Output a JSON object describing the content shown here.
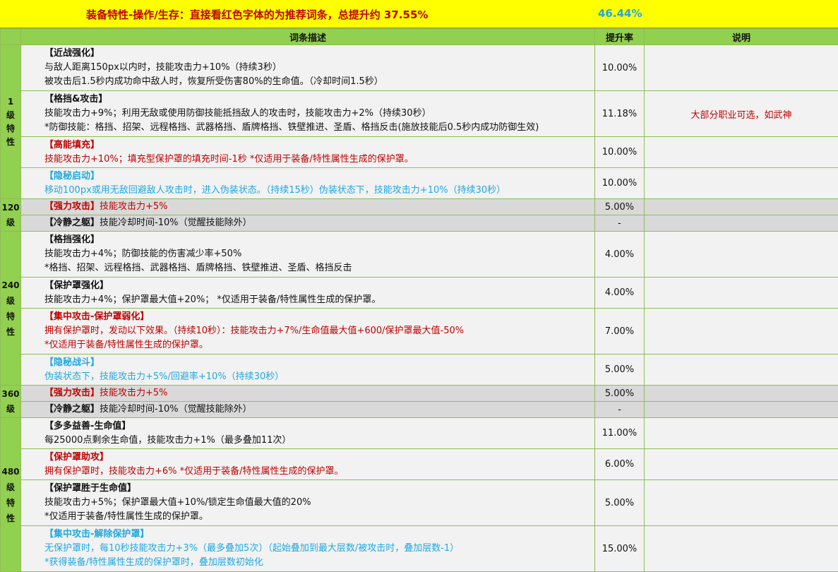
{
  "banner": {
    "title": "装备特性-操作/生存：直接看红色字体的为推荐词条，总提升约 37.55%",
    "total_alt": "46.44%"
  },
  "headers": {
    "description": "词条描述",
    "rate": "提升率",
    "note": "说明"
  },
  "levels": {
    "l1": "1\n级\n特\n性",
    "l120": "120\n级",
    "l240": "240\n级\n特\n性",
    "l360": "360\n级",
    "l480": "480\n级\n特\n性"
  },
  "rows": [
    {
      "name": "【近战强化】",
      "lines": [
        "与敌人距离150px以内时，技能攻击力+10%（持续3秒）",
        "被攻击后1.5秒内成功命中敌人时，恢复所受伤害80%的生命值。（冷却时间1.5秒）"
      ],
      "rate": "10.00%"
    },
    {
      "name": "【格挡&攻击】",
      "lines": [
        "技能攻击力+9%；利用无敌或使用防御技能抵挡敌人的攻击时，技能攻击力+2%（持续30秒）",
        "*防御技能：格挡、招架、远程格挡、武器格挡、盾牌格挡、铁壁推进、圣盾、格挡反击(施放技能后0.5秒内成功防御生效)"
      ],
      "rate": "11.18%",
      "note": "大部分职业可选，如武神"
    },
    {
      "name": "【高能填充】",
      "lines": [
        "技能攻击力+10%；填充型保护罩的填充时间-1秒 *仅适用于装备/特性属性生成的保护罩。"
      ],
      "rate": "10.00%"
    },
    {
      "name": "【隐秘启动】",
      "lines": [
        "移动100px或用无敌回避敌人攻击时，进入伪装状态。（持续15秒）伪装状态下，技能攻击力+10%（持续30秒）"
      ],
      "rate": "10.00%"
    },
    {
      "name": "【强力攻击】",
      "inline": "技能攻击力+5%",
      "rate": "5.00%"
    },
    {
      "name": "【冷静之躯】",
      "inline": "技能冷却时间-10%（觉醒技能除外）",
      "rate": "-"
    },
    {
      "name": "【格挡强化】",
      "lines": [
        "技能攻击力+4%；防御技能的伤害减少率+50%",
        "*格挡、招架、远程格挡、武器格挡、盾牌格挡、铁壁推进、圣盾、格挡反击"
      ],
      "rate": "4.00%"
    },
    {
      "name": "【保护罩强化】",
      "lines": [
        "技能攻击力+4%；保护罩最大值+20%； *仅适用于装备/特性属性生成的保护罩。"
      ],
      "rate": "4.00%"
    },
    {
      "name": "【集中攻击-保护罩弱化】",
      "lines": [
        "拥有保护罩时，发动以下效果。（持续10秒）：技能攻击力+7%/生命值最大值+600/保护罩最大值-50%",
        "*仅适用于装备/特性属性生成的保护罩。"
      ],
      "rate": "7.00%"
    },
    {
      "name": "【隐秘战斗】",
      "lines": [
        "伪装状态下，技能攻击力+5%/回避率+10%（持续30秒）"
      ],
      "rate": "5.00%"
    },
    {
      "name": "【强力攻击】",
      "inline": "技能攻击力+5%",
      "rate": "5.00%"
    },
    {
      "name": "【冷静之躯】",
      "inline": "技能冷却时间-10%（觉醒技能除外）",
      "rate": "-"
    },
    {
      "name": "【多多益善-生命值】",
      "lines": [
        "每25000点剩余生命值，技能攻击力+1%（最多叠加11次）"
      ],
      "rate": "11.00%"
    },
    {
      "name": "【保护罩助攻】",
      "lines": [
        "拥有保护罩时，技能攻击力+6% *仅适用于装备/特性属性生成的保护罩。"
      ],
      "rate": "6.00%"
    },
    {
      "name": "【保护罩胜于生命值】",
      "lines": [
        "技能攻击力+5%；保护罩最大值+10%/锁定生命值最大值的20%",
        "*仅适用于装备/特性属性生成的保护罩。"
      ],
      "rate": "5.00%"
    },
    {
      "name": "【集中攻击-解除保护罩】",
      "lines": [
        "无保护罩时，每10秒技能攻击力+3%（最多叠加5次）（起始叠加到最大层数/被攻击时，叠加层数-1）",
        "*获得装备/特性属性生成的保护罩时，叠加层数初始化"
      ],
      "rate": "15.00%"
    }
  ],
  "colors": {
    "recommended": "#c00000",
    "alternative": "#20a8e0",
    "header_bg": "#92d050",
    "banner_bg": "#ffff00"
  }
}
